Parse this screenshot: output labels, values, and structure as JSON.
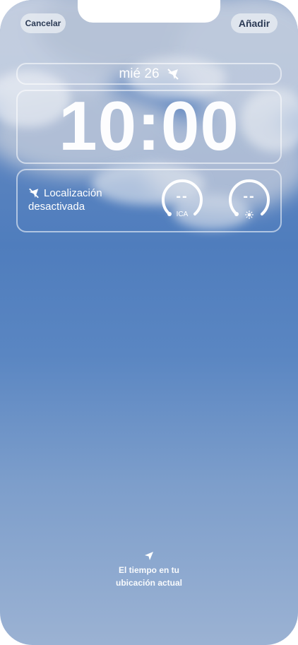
{
  "toolbar": {
    "cancel_label": "Cancelar",
    "add_label": "Añadir"
  },
  "lockscreen": {
    "date": "mié 26",
    "time": "10:00"
  },
  "widgets": {
    "location_line1": "Localización",
    "location_line2": "desactivada",
    "aqi_value": "--",
    "aqi_label": "ICA",
    "uv_value": "--"
  },
  "weather_hint": {
    "line1": "El tiempo en tu",
    "line2": "ubicación actual"
  },
  "colors": {
    "sky_top": "#6f8fbf",
    "sky_middle": "#4f7dbd",
    "sky_bottom": "#9bb2d3",
    "button_text": "#2b3a55"
  },
  "icons": {
    "location_disabled": "location-slash-icon",
    "location_arrow": "location-arrow-icon",
    "sun": "sun-icon"
  }
}
